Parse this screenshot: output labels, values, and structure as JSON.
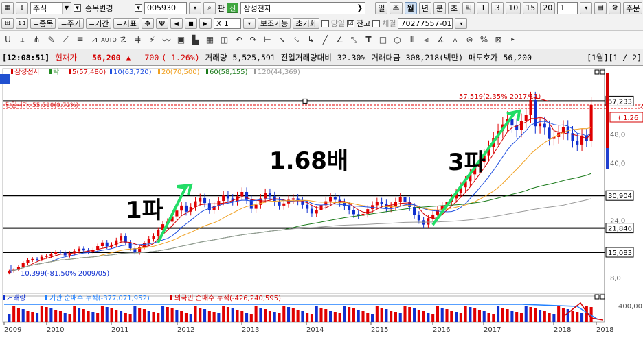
{
  "toolbar1": {
    "market_type": "주식",
    "change_label": "종목변경",
    "code": "005930",
    "pan_label": "판",
    "sin_badge": "신",
    "stock_name": "삼성전자",
    "period_buttons": [
      "일",
      "주",
      "월",
      "년",
      "분",
      "초",
      "틱"
    ],
    "active_period": "월",
    "num_buttons": [
      "1",
      "3",
      "10",
      "15",
      "20"
    ],
    "count_value": "1",
    "order_label": "주문"
  },
  "toolbar2": {
    "tabs": [
      "=종목",
      "=주기",
      "=기간",
      "=지표"
    ],
    "multiplier": "X 1",
    "aux_label": "보조기능",
    "reset_label": "초기화",
    "check1_label": "당일",
    "check2_label": "잔고",
    "check2_checked": "☑",
    "check3_label": "체결",
    "account": "70277557-01"
  },
  "quote": {
    "time": "[12:08:51]",
    "label": "현재가",
    "price": "56,200",
    "arrow": "▲",
    "change": "700",
    "change_pct": "( 1.26%)",
    "volume_label": "거래량",
    "volume": "5,525,591",
    "prev_vol_label": "전일거래량대비",
    "prev_vol_pct": "32.30%",
    "amount_label": "거래대금",
    "amount": "308,218(백만)",
    "ask_label": "매도호가",
    "ask": "56,200",
    "page": "[1월][1 / 2]"
  },
  "chart_data": {
    "type": "line",
    "title": "",
    "legend": [
      "삼성전자",
      "락",
      "5(57,480)",
      "10(63,720)",
      "20(70,500)",
      "60(58,155)",
      "120(44,369)"
    ],
    "legend_colors": [
      "#d40000",
      "#228b22",
      "#d40000",
      "#2050e0",
      "#f0a020",
      "#1a7a1a",
      "#999999"
    ],
    "x_labels": [
      "2009",
      "2010",
      "2011",
      "2012",
      "2013",
      "2014",
      "2015",
      "2016",
      "2017",
      "2018",
      "2018"
    ],
    "y_ticks": [
      "48,0",
      "40,0",
      "24,0",
      "8,0"
    ],
    "price_labels": [
      "57,233",
      "30,904",
      "21,846",
      "15,083"
    ],
    "right_overflow_labels": [
      ".2",
      "( 1.26"
    ],
    "hlines": [
      57233,
      30904,
      21846,
      15083
    ],
    "ylim": [
      4000,
      64000
    ],
    "annotation_high": "57,519(2.35% 2017/11)",
    "annotation_low": "10,399(-81.50% 2009/05)",
    "dashed_label": "당일시가: 55,500(0.72%)",
    "text_wave1": "1파",
    "text_wave3": "3파",
    "text_ratio": "1.68배",
    "monthly_close": [
      9800,
      10200,
      11000,
      12100,
      12900,
      13200,
      13100,
      13800,
      14000,
      14600,
      15200,
      15000,
      14200,
      14800,
      15400,
      16100,
      15600,
      15100,
      15700,
      16800,
      17800,
      16700,
      17200,
      18400,
      19600,
      17800,
      16200,
      15000,
      16600,
      17600,
      18800,
      19600,
      21200,
      22900,
      23600,
      25100,
      26700,
      28100,
      26400,
      27700,
      29300,
      30200,
      28800,
      26900,
      27900,
      29400,
      30900,
      30100,
      29300,
      30700,
      31900,
      29700,
      27200,
      28300,
      30100,
      31600,
      30700,
      29200,
      28100,
      28700,
      29700,
      30100,
      29400,
      28300,
      27200,
      25900,
      26900,
      28200,
      29300,
      30400,
      29700,
      28900,
      27900,
      26800,
      25700,
      25300,
      25800,
      27100,
      28200,
      29100,
      28600,
      27400,
      27900,
      29100,
      30400,
      29200,
      27700,
      25500,
      24000,
      22800,
      24600,
      25600,
      26800,
      28100,
      29200,
      30100,
      31600,
      33200,
      34900,
      36800,
      38800,
      40300,
      42100,
      44500,
      46800,
      48900,
      50700,
      52300,
      50400,
      49100,
      51700,
      53300,
      57519,
      50200,
      50900,
      49800,
      46700,
      47200,
      48400,
      49900,
      48300,
      46100,
      45100,
      47600,
      46200,
      56200
    ],
    "volume_label": "거래량",
    "inst_label": "기관 순매수 누적(-377,071,952)",
    "foreign_label": "외국인 순매수 누적(-426,240,595)",
    "volume_tick": "400,00"
  }
}
